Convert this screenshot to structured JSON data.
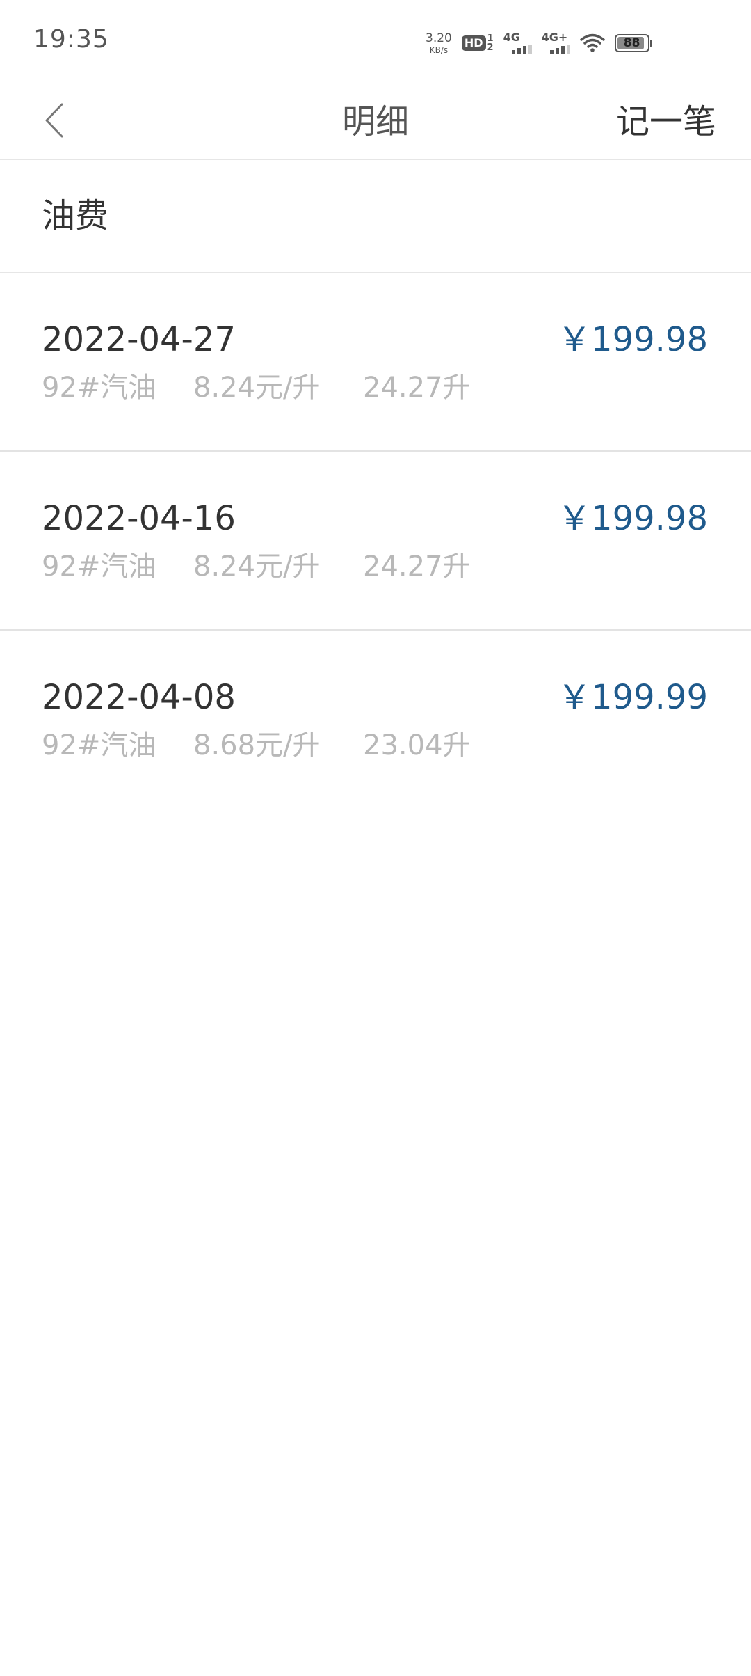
{
  "status_bar": {
    "time": "19:35",
    "net_speed_value": "3.20",
    "net_speed_unit": "KB/s",
    "hd_label": "HD",
    "hd_sub_top": "1",
    "hd_sub_bottom": "2",
    "signal1_label": "4G",
    "signal2_label": "4G+",
    "battery_level": "88"
  },
  "nav": {
    "title": "明细",
    "add_label": "记一笔"
  },
  "category": {
    "title": "油费"
  },
  "records": [
    {
      "date": "2022-04-27",
      "amount": "￥199.98",
      "fuel_type": "92#汽油",
      "unit_price": "8.24元/升",
      "volume": "24.27升"
    },
    {
      "date": "2022-04-16",
      "amount": "￥199.98",
      "fuel_type": "92#汽油",
      "unit_price": "8.24元/升",
      "volume": "24.27升"
    },
    {
      "date": "2022-04-08",
      "amount": "￥199.99",
      "fuel_type": "92#汽油",
      "unit_price": "8.68元/升",
      "volume": "23.04升"
    }
  ],
  "colors": {
    "amount": "#1f5a8c",
    "secondary_text": "#b8b8b8",
    "divider": "#e3e3e3"
  }
}
